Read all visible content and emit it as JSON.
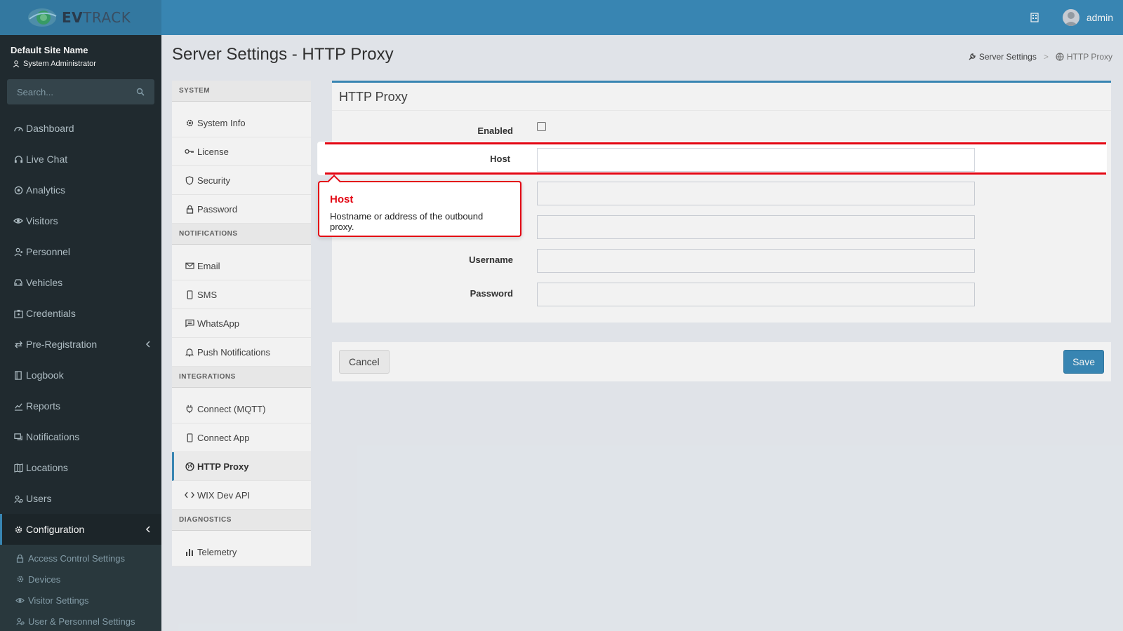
{
  "header": {
    "logo_text_bold": "EV",
    "logo_text_rest": "TRACK",
    "username": "admin"
  },
  "sidebar": {
    "site_name": "Default Site Name",
    "role": "System Administrator",
    "search_placeholder": "Search...",
    "items": [
      {
        "label": "Dashboard",
        "icon": "dashboard-icon"
      },
      {
        "label": "Live Chat",
        "icon": "headset-icon"
      },
      {
        "label": "Analytics",
        "icon": "analytics-icon"
      },
      {
        "label": "Visitors",
        "icon": "eye-icon"
      },
      {
        "label": "Personnel",
        "icon": "personnel-icon"
      },
      {
        "label": "Vehicles",
        "icon": "car-icon"
      },
      {
        "label": "Credentials",
        "icon": "credentials-icon"
      },
      {
        "label": "Pre-Registration",
        "icon": "arrows-icon"
      },
      {
        "label": "Logbook",
        "icon": "book-icon"
      },
      {
        "label": "Reports",
        "icon": "chart-icon"
      },
      {
        "label": "Notifications",
        "icon": "chat-icon"
      },
      {
        "label": "Locations",
        "icon": "map-icon"
      },
      {
        "label": "Users",
        "icon": "users-icon"
      },
      {
        "label": "Configuration",
        "icon": "gear-icon"
      }
    ],
    "sub_items": [
      {
        "label": "Access Control Settings",
        "icon": "lock-icon"
      },
      {
        "label": "Devices",
        "icon": "gear-icon"
      },
      {
        "label": "Visitor Settings",
        "icon": "eye-icon"
      },
      {
        "label": "User & Personnel Settings",
        "icon": "users-icon"
      }
    ]
  },
  "page": {
    "title": "Server Settings - HTTP Proxy",
    "breadcrumb": [
      "Server Settings",
      "HTTP Proxy"
    ]
  },
  "settings_menu": {
    "sections": [
      {
        "header": "SYSTEM",
        "items": [
          "System Info",
          "License",
          "Security",
          "Password"
        ]
      },
      {
        "header": "NOTIFICATIONS",
        "items": [
          "Email",
          "SMS",
          "WhatsApp",
          "Push Notifications"
        ]
      },
      {
        "header": "INTEGRATIONS",
        "items": [
          "Connect (MQTT)",
          "Connect App",
          "HTTP Proxy",
          "WIX Dev API"
        ]
      },
      {
        "header": "DIAGNOSTICS",
        "items": [
          "Telemetry"
        ]
      }
    ]
  },
  "form": {
    "box_title": "HTTP Proxy",
    "enabled_label": "Enabled",
    "host_label": "Host",
    "host_value": "",
    "port_value": "",
    "field3_value": "",
    "username_label": "Username",
    "username_value": "",
    "password_label": "Password",
    "password_value": ""
  },
  "actions": {
    "cancel": "Cancel",
    "save": "Save"
  },
  "tooltip": {
    "title": "Host",
    "body": "Hostname or address of the outbound proxy."
  },
  "colors": {
    "header_bg": "#3c8dbc",
    "sidebar_bg": "#222d32",
    "highlight": "#e30613"
  }
}
